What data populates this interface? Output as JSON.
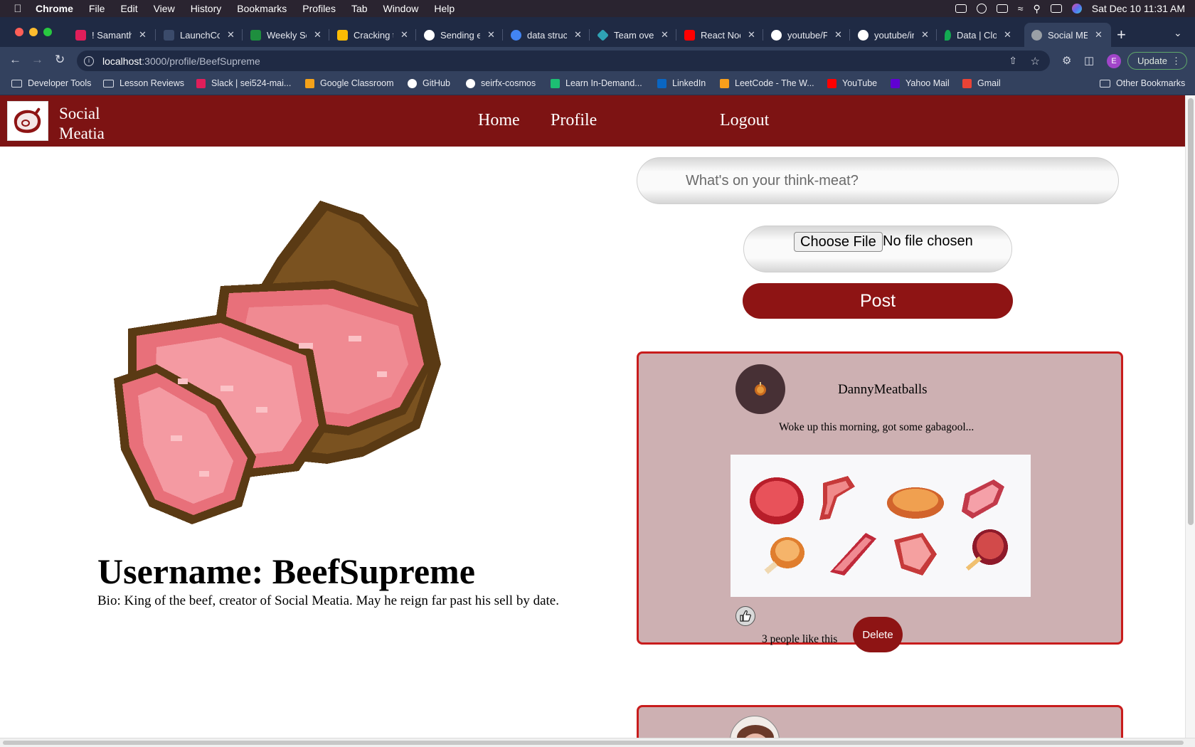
{
  "menubar": {
    "items": [
      "Chrome",
      "File",
      "Edit",
      "View",
      "History",
      "Bookmarks",
      "Profiles",
      "Tab",
      "Window",
      "Help"
    ],
    "clock": "Sat Dec 10  11:31 AM"
  },
  "tabs": [
    {
      "title": "! Samantha",
      "color": "#e01e5a"
    },
    {
      "title": "LaunchCode",
      "color": "#3b4b6b"
    },
    {
      "title": "Weekly Schedule",
      "color": "#1e8e3e"
    },
    {
      "title": "Cracking the",
      "color": "#fbbc04"
    },
    {
      "title": "Sending emails",
      "color": "#ffffff"
    },
    {
      "title": "data structures",
      "color": "#4285f4"
    },
    {
      "title": "Team overview",
      "color": "#2fa3b5"
    },
    {
      "title": "React Node",
      "color": "#ff0000"
    },
    {
      "title": "youtube/Pl",
      "color": "#ffffff"
    },
    {
      "title": "youtube/ir",
      "color": "#ffffff"
    },
    {
      "title": "Data | Cloud",
      "color": "#13aa52"
    },
    {
      "title": "Social MEATia",
      "color": "#9aa0a6"
    }
  ],
  "browser": {
    "url_host": "localhost",
    "url_path": ":3000/profile/BeefSupreme",
    "profile_initial": "E",
    "update_label": "Update"
  },
  "bookmarks": {
    "items": [
      {
        "label": "Developer Tools",
        "type": "folder"
      },
      {
        "label": "Lesson Reviews",
        "type": "folder"
      },
      {
        "label": "Slack | sei524-mai...",
        "color": "#e01e5a"
      },
      {
        "label": "Google Classroom",
        "color": "#f4a21a"
      },
      {
        "label": "GitHub",
        "color": "#ffffff"
      },
      {
        "label": "seirfx-cosmos",
        "color": "#ffffff"
      },
      {
        "label": "Learn In-Demand...",
        "color": "#1dbf73"
      },
      {
        "label": "LinkedIn",
        "color": "#0a66c2"
      },
      {
        "label": "LeetCode - The W...",
        "color": "#f89f1b"
      },
      {
        "label": "YouTube",
        "color": "#ff0000"
      },
      {
        "label": "Yahoo Mail",
        "color": "#6001d2"
      },
      {
        "label": "Gmail",
        "color": "#ea4335"
      }
    ],
    "other_label": "Other Bookmarks"
  },
  "site": {
    "brand": "Social Meatia",
    "nav": {
      "home": "Home",
      "profile": "Profile",
      "logout": "Logout"
    }
  },
  "profile": {
    "username": "Username: BeefSupreme",
    "bio": "Bio: King of the beef, creator of Social Meatia. May he reign far past his sell by date."
  },
  "composer": {
    "placeholder": "What's on your think-meat?",
    "file_button": "Choose File",
    "file_status": "No file chosen",
    "post_button": "Post"
  },
  "posts": [
    {
      "author": "DannyMeatballs",
      "text": "Woke up this morning, got some gabagool...",
      "likes_text": "3 people like this",
      "delete_label": "Delete"
    }
  ],
  "colors": {
    "brand_red": "#7d1313",
    "button_red": "#8e1414",
    "card_bg": "#cdb0b2",
    "card_border": "#c81c1c"
  }
}
